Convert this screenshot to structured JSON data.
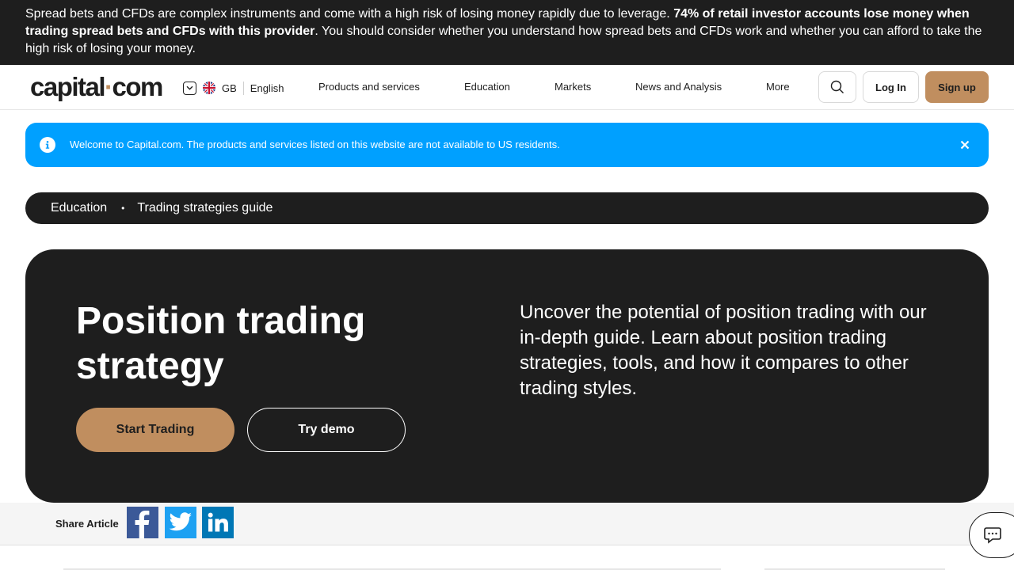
{
  "risk_banner": {
    "part1": "Spread bets and CFDs are complex instruments and come with a high risk of losing money rapidly due to leverage. ",
    "bold": "74% of retail investor accounts lose money when trading spread bets and CFDs with this provider",
    "part2": ". You should consider whether you understand how spread bets and CFDs work and whether you can afford to take the high risk of losing your money."
  },
  "header": {
    "logo_left": "capital",
    "logo_dot": "·",
    "logo_right": "com",
    "region": "GB",
    "language": "English",
    "nav": [
      "Products and services",
      "Education",
      "Markets",
      "News and Analysis",
      "More"
    ],
    "login_label": "Log In",
    "signup_label": "Sign up",
    "search_icon": "search-icon"
  },
  "notice": {
    "text": "Welcome to Capital.com. The products and services listed on this website are not available to US residents.",
    "icon": "info-icon",
    "close_icon": "close-icon"
  },
  "breadcrumb": {
    "items": [
      "Education",
      "Trading strategies guide"
    ],
    "separator": "•"
  },
  "hero": {
    "title": "Position trading strategy",
    "description": "Uncover the potential of position trading with our in-depth guide. Learn about position trading strategies, tools, and how it compares to other trading styles.",
    "start_label": "Start Trading",
    "demo_label": "Try demo"
  },
  "share": {
    "label": "Share Article",
    "networks": [
      "facebook-icon",
      "twitter-icon",
      "linkedin-icon"
    ]
  },
  "colors": {
    "dark": "#1e1e1e",
    "accent": "#c08e5f",
    "notice_blue": "#00a0ff"
  }
}
